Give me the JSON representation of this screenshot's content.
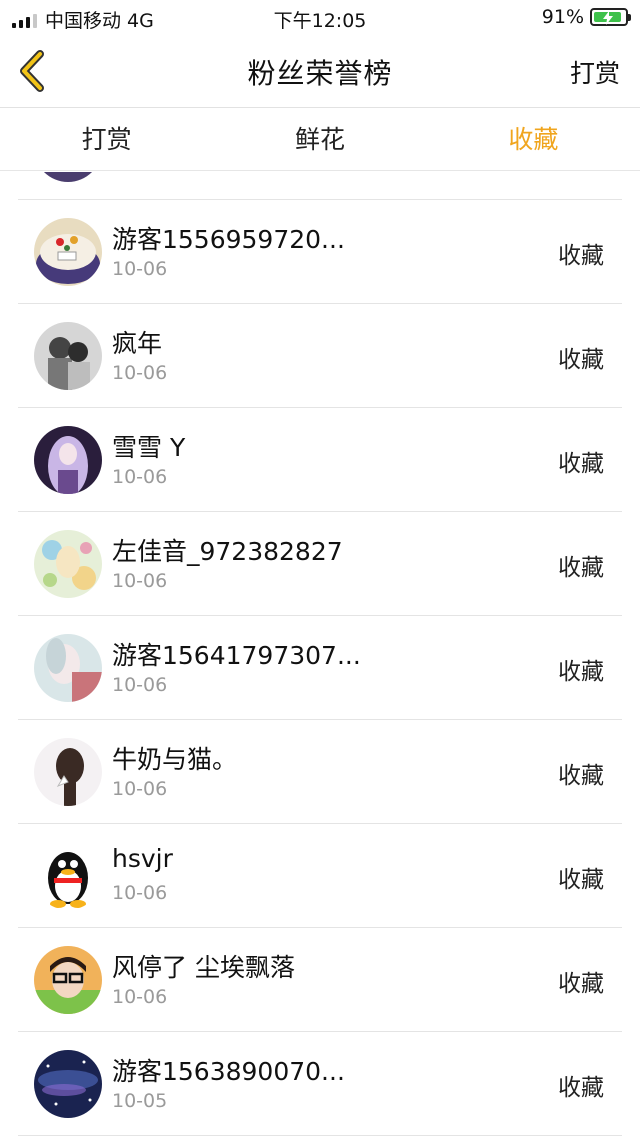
{
  "status_bar": {
    "carrier": "中国移动 4G",
    "time": "下午12:05",
    "battery": "91%"
  },
  "nav": {
    "title": "粉丝荣誉榜",
    "action": "打赏"
  },
  "tabs": [
    {
      "label": "打赏",
      "active": false
    },
    {
      "label": "鲜花",
      "active": false
    },
    {
      "label": "收藏",
      "active": true
    }
  ],
  "colors": {
    "accent": "#f0a51e",
    "battery": "#3ec14b",
    "secondary_text": "#9a9a9a"
  },
  "list": [
    {
      "name": "游客1556959720...",
      "date": "10-06",
      "action": "收藏",
      "avatar": "cake-avatar"
    },
    {
      "name": "疯年",
      "date": "10-06",
      "action": "收藏",
      "avatar": "couple-avatar"
    },
    {
      "name": "雪雪 Y",
      "date": "10-06",
      "action": "收藏",
      "avatar": "anime-girl-avatar"
    },
    {
      "name": "左佳音_972382827",
      "date": "10-06",
      "action": "收藏",
      "avatar": "illustration-avatar"
    },
    {
      "name": "游客15641797307...",
      "date": "10-06",
      "action": "收藏",
      "avatar": "selfie-avatar"
    },
    {
      "name": "牛奶与猫。",
      "date": "10-06",
      "action": "收藏",
      "avatar": "girl-back-avatar"
    },
    {
      "name": "hsvjr",
      "date": "10-06",
      "action": "收藏",
      "avatar": "qq-penguin-avatar"
    },
    {
      "name": "风停了 尘埃飘落",
      "date": "10-06",
      "action": "收藏",
      "avatar": "boy-glasses-avatar"
    },
    {
      "name": "游客1563890070...",
      "date": "10-05",
      "action": "收藏",
      "avatar": "galaxy-avatar"
    }
  ]
}
